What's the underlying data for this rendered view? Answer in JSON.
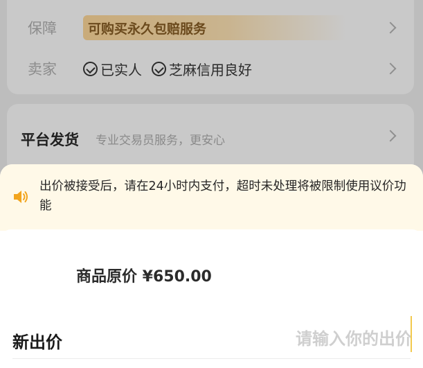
{
  "background": {
    "guarantee": {
      "label": "保障",
      "value": "可购买永久包赔服务"
    },
    "seller": {
      "label": "卖家",
      "tags": [
        "已实人",
        "芝麻信用良好"
      ]
    },
    "shipping": {
      "title": "平台发货",
      "subtitle": "专业交易员服务，更安心"
    }
  },
  "sheet": {
    "notice": {
      "icon": "speaker-icon",
      "text": "出价被接受后，请在24小时内支付，超时未处理将被限制使用议价功能"
    },
    "original_price": "商品原价 ¥650.00",
    "new_bid": {
      "label": "新出价",
      "placeholder": "请输入你的出价",
      "value": ""
    }
  },
  "colors": {
    "accent": "#f2a51e",
    "notice_bg": "#fff9e8",
    "guarantee_text": "#6b4a1d"
  }
}
